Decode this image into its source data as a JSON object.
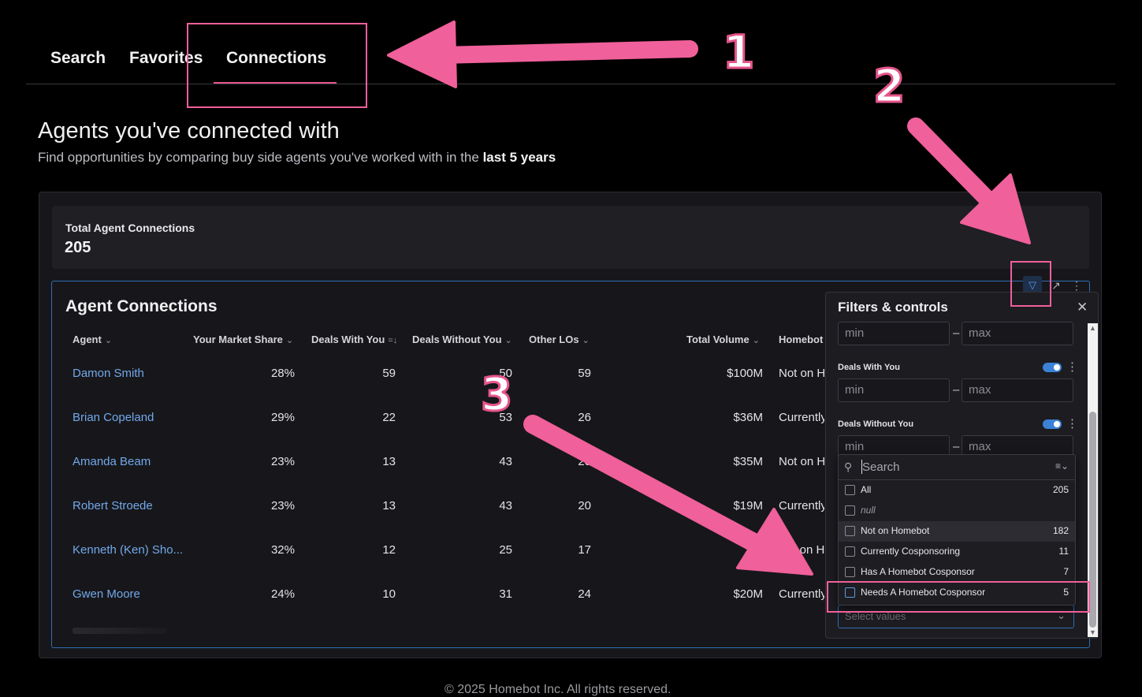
{
  "tabs": [
    {
      "label": "Search"
    },
    {
      "label": "Favorites"
    },
    {
      "label": "Connections",
      "active": true
    }
  ],
  "page": {
    "title": "Agents you've connected with",
    "subtitle_prefix": "Find opportunities by comparing buy side agents you've worked with in the ",
    "subtitle_bold": "last 5 years"
  },
  "stat": {
    "label": "Total Agent Connections",
    "value": "205"
  },
  "table": {
    "title": "Agent Connections",
    "columns": [
      "Agent",
      "Your Market Share",
      "Deals With You",
      "Deals Without You",
      "Other LOs",
      "Total Volume",
      "Homebot"
    ],
    "rows": [
      {
        "agent": "Damon Smith",
        "share": "28%",
        "with": "59",
        "without": "50",
        "other": "59",
        "volume": "$100M",
        "homebot": "Not on H"
      },
      {
        "agent": "Brian Copeland",
        "share": "29%",
        "with": "22",
        "without": "53",
        "other": "26",
        "volume": "$36M",
        "homebot": "Currently"
      },
      {
        "agent": "Amanda Beam",
        "share": "23%",
        "with": "13",
        "without": "43",
        "other": "20",
        "volume": "$35M",
        "homebot": "Not on H"
      },
      {
        "agent": "Robert Stroede",
        "share": "23%",
        "with": "13",
        "without": "43",
        "other": "20",
        "volume": "$19M",
        "homebot": "Currently"
      },
      {
        "agent": "Kenneth (Ken) Sho...",
        "share": "32%",
        "with": "12",
        "without": "25",
        "other": "17",
        "volume": "$1",
        "homebot": "ot on H"
      },
      {
        "agent": "Gwen Moore",
        "share": "24%",
        "with": "10",
        "without": "31",
        "other": "24",
        "volume": "$20M",
        "homebot": "Currently"
      }
    ]
  },
  "filters": {
    "title": "Filters & controls",
    "min_placeholder": "min",
    "max_placeholder": "max",
    "dash": "–",
    "deals_with_label": "Deals With You",
    "deals_without_label": "Deals Without You",
    "search_placeholder": "Search",
    "select_placeholder": "Select values",
    "options": [
      {
        "label": "All",
        "count": "205"
      },
      {
        "label": "null",
        "count": ""
      },
      {
        "label": "Not on Homebot",
        "count": "182"
      },
      {
        "label": "Currently Cosponsoring",
        "count": "11"
      },
      {
        "label": "Has A Homebot Cosponsor",
        "count": "7"
      },
      {
        "label": "Needs A Homebot Cosponsor",
        "count": "5"
      }
    ]
  },
  "annotations": {
    "step1": "1",
    "step2": "2",
    "step3": "3",
    "color": "#e5548a"
  },
  "footer": "© 2025 Homebot Inc. All rights reserved."
}
